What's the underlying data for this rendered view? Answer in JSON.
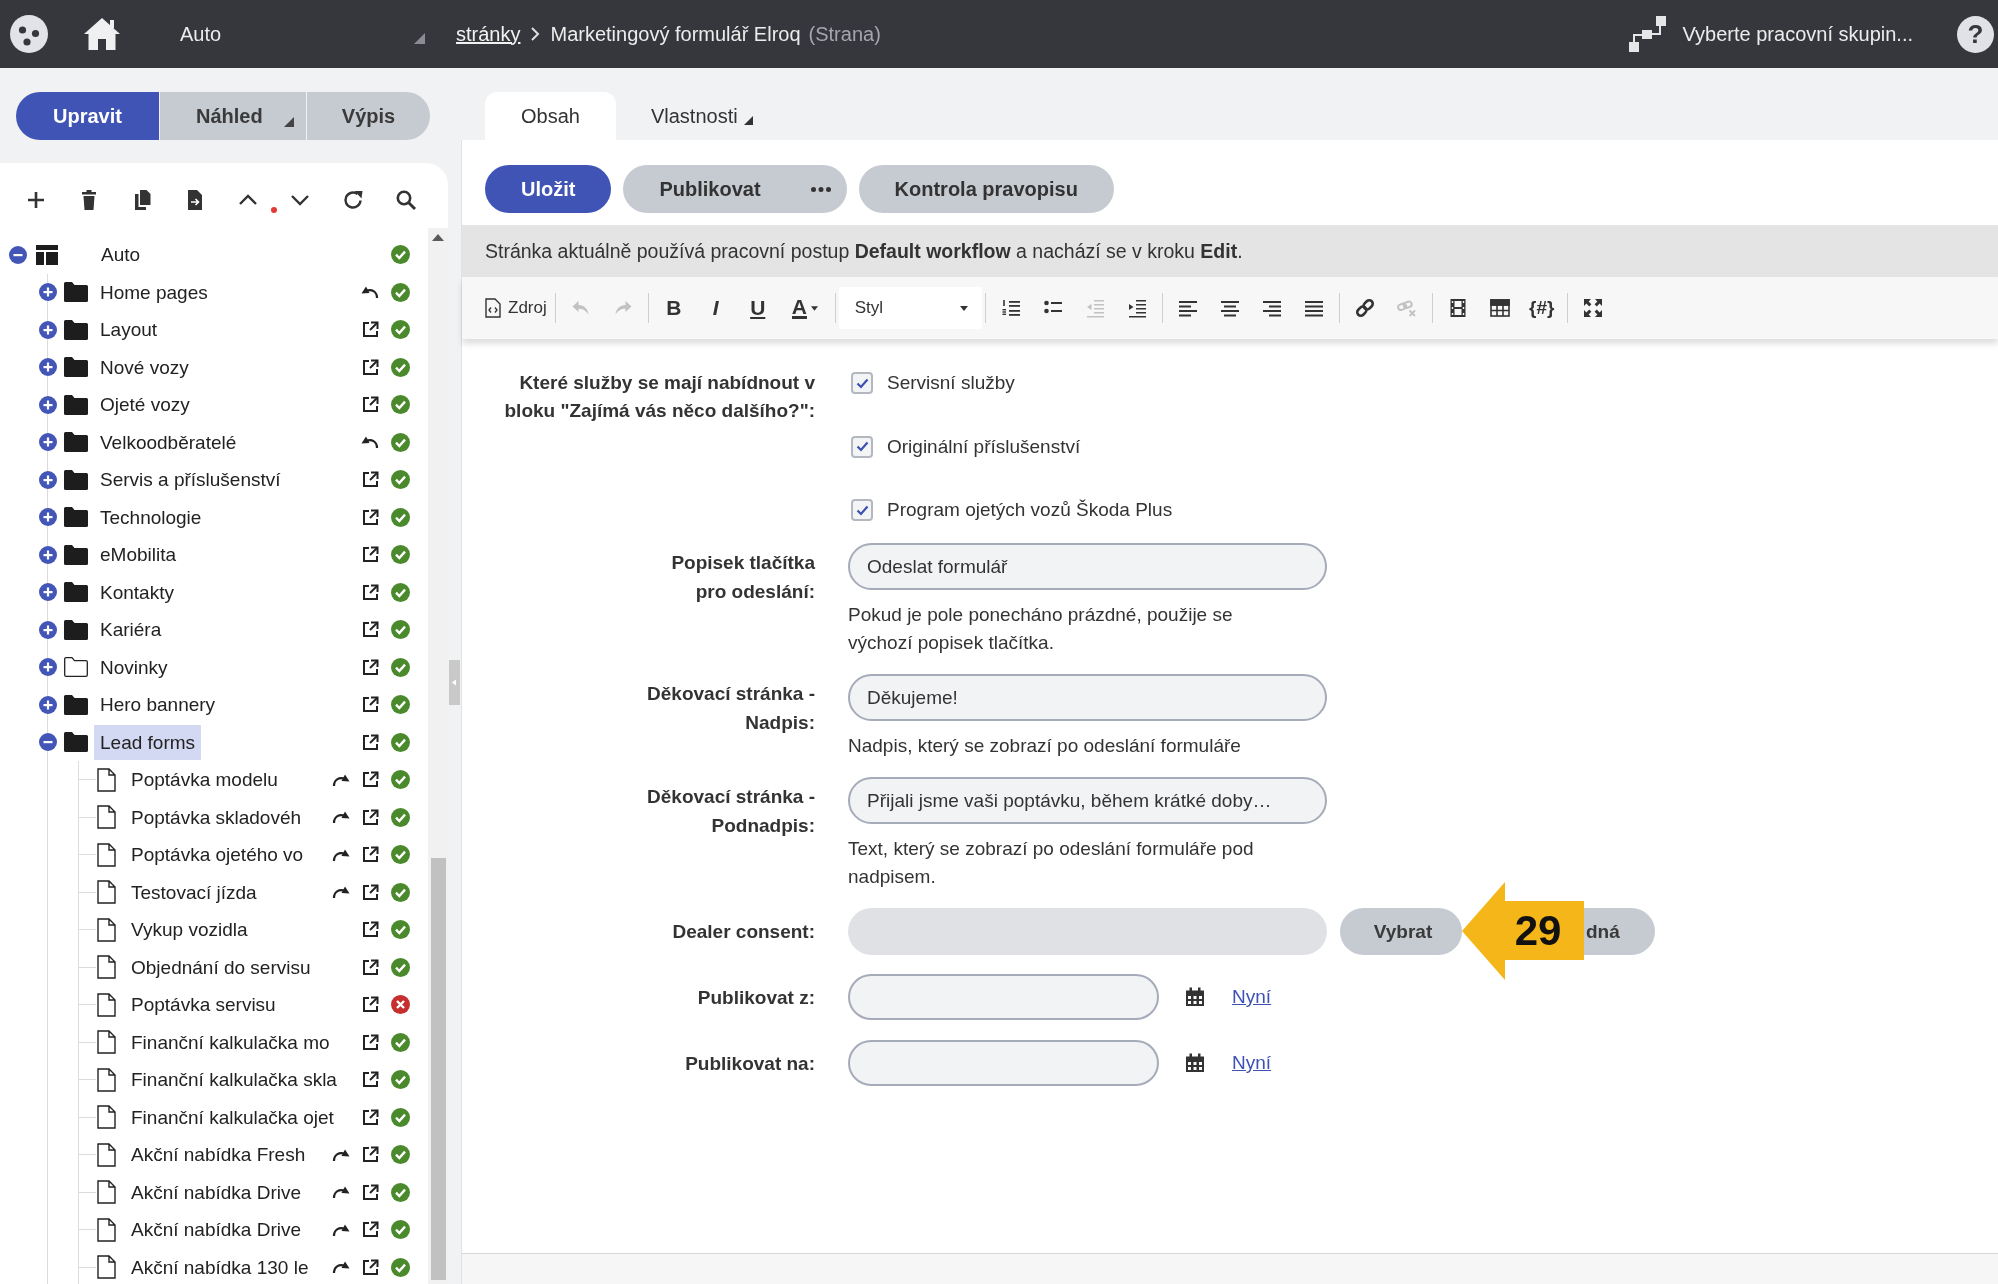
{
  "topbar": {
    "site": "Auto",
    "breadcrumb": {
      "link": "stránky",
      "current": "Marketingový formulář Elroq",
      "type": "(Strana)"
    },
    "workgroup": "Vyberte pracovní skupin...",
    "help": "?"
  },
  "modes": [
    {
      "label": "Upravit",
      "selected": true,
      "dropdown": false
    },
    {
      "label": "Náhled",
      "selected": false,
      "dropdown": true
    },
    {
      "label": "Výpis",
      "selected": false,
      "dropdown": false
    }
  ],
  "tree": {
    "items": [
      {
        "name": "Auto",
        "kind": "site",
        "expanded": true,
        "selected": false,
        "error": false,
        "undo": false,
        "redo": false,
        "external": false,
        "children": [
          {
            "name": "Home pages",
            "kind": "folder",
            "outline": false,
            "expanded": false,
            "selected": false,
            "error": false,
            "undo": true,
            "redo": false,
            "external": false
          },
          {
            "name": "Layout",
            "kind": "folder",
            "outline": false,
            "expanded": false,
            "selected": false,
            "error": false,
            "undo": false,
            "redo": false,
            "external": true
          },
          {
            "name": "Nové vozy",
            "kind": "folder",
            "outline": false,
            "expanded": false,
            "selected": false,
            "error": false,
            "undo": false,
            "redo": false,
            "external": true
          },
          {
            "name": "Ojeté vozy",
            "kind": "folder",
            "outline": false,
            "expanded": false,
            "selected": false,
            "error": false,
            "undo": false,
            "redo": false,
            "external": true
          },
          {
            "name": "Velkoodběratelé",
            "kind": "folder",
            "outline": false,
            "expanded": false,
            "selected": false,
            "error": false,
            "undo": true,
            "redo": false,
            "external": false
          },
          {
            "name": "Servis a příslušenství",
            "kind": "folder",
            "outline": false,
            "expanded": false,
            "selected": false,
            "error": false,
            "undo": false,
            "redo": false,
            "external": true
          },
          {
            "name": "Technologie",
            "kind": "folder",
            "outline": false,
            "expanded": false,
            "selected": false,
            "error": false,
            "undo": false,
            "redo": false,
            "external": true
          },
          {
            "name": "eMobilita",
            "kind": "folder",
            "outline": false,
            "expanded": false,
            "selected": false,
            "error": false,
            "undo": false,
            "redo": false,
            "external": true
          },
          {
            "name": "Kontakty",
            "kind": "folder",
            "outline": false,
            "expanded": false,
            "selected": false,
            "error": false,
            "undo": false,
            "redo": false,
            "external": true
          },
          {
            "name": "Kariéra",
            "kind": "folder",
            "outline": false,
            "expanded": false,
            "selected": false,
            "error": false,
            "undo": false,
            "redo": false,
            "external": true
          },
          {
            "name": "Novinky",
            "kind": "folder",
            "outline": true,
            "expanded": false,
            "selected": false,
            "error": false,
            "undo": false,
            "redo": false,
            "external": true
          },
          {
            "name": "Hero bannery",
            "kind": "folder",
            "outline": false,
            "expanded": false,
            "selected": false,
            "error": false,
            "undo": false,
            "redo": false,
            "external": true
          },
          {
            "name": "Lead forms",
            "kind": "folder",
            "outline": false,
            "expanded": true,
            "selected": true,
            "error": false,
            "undo": false,
            "redo": false,
            "external": true,
            "children": [
              {
                "name": "Poptávka modelu",
                "kind": "page",
                "selected": false,
                "error": false,
                "undo": false,
                "redo": true,
                "external": true
              },
              {
                "name": "Poptávka skladovéh",
                "kind": "page",
                "selected": false,
                "error": false,
                "undo": false,
                "redo": true,
                "external": true
              },
              {
                "name": "Poptávka ojetého vo",
                "kind": "page",
                "selected": false,
                "error": false,
                "undo": false,
                "redo": true,
                "external": true
              },
              {
                "name": "Testovací jízda",
                "kind": "page",
                "selected": false,
                "error": false,
                "undo": false,
                "redo": true,
                "external": true
              },
              {
                "name": "Vykup vozidla",
                "kind": "page",
                "selected": false,
                "error": false,
                "undo": false,
                "redo": false,
                "external": true
              },
              {
                "name": "Objednání do servisu",
                "kind": "page",
                "selected": false,
                "error": false,
                "undo": false,
                "redo": false,
                "external": true
              },
              {
                "name": "Poptávka servisu",
                "kind": "page",
                "selected": false,
                "error": true,
                "undo": false,
                "redo": false,
                "external": true
              },
              {
                "name": "Finanční kalkulačka mo",
                "kind": "page",
                "selected": false,
                "error": false,
                "undo": false,
                "redo": false,
                "external": true
              },
              {
                "name": "Finanční kalkulačka skla",
                "kind": "page",
                "selected": false,
                "error": false,
                "undo": false,
                "redo": false,
                "external": true
              },
              {
                "name": "Finanční kalkulačka ojet",
                "kind": "page",
                "selected": false,
                "error": false,
                "undo": false,
                "redo": false,
                "external": true
              },
              {
                "name": "Akční nabídka Fresh",
                "kind": "page",
                "selected": false,
                "error": false,
                "undo": false,
                "redo": true,
                "external": true
              },
              {
                "name": "Akční nabídka Drive",
                "kind": "page",
                "selected": false,
                "error": false,
                "undo": false,
                "redo": true,
                "external": true
              },
              {
                "name": "Akční nabídka Drive",
                "kind": "page",
                "selected": false,
                "error": false,
                "undo": false,
                "redo": true,
                "external": true
              },
              {
                "name": "Akční nabídka 130 le",
                "kind": "page",
                "selected": false,
                "error": false,
                "undo": false,
                "redo": true,
                "external": true
              }
            ]
          }
        ]
      }
    ]
  },
  "tabs": [
    {
      "label": "Obsah",
      "selected": true,
      "dropdown": false
    },
    {
      "label": "Vlastnosti",
      "selected": false,
      "dropdown": true
    }
  ],
  "actions": [
    {
      "label": "Uložit",
      "kind": "primary"
    },
    {
      "label": "Publikovat",
      "kind": "split"
    },
    {
      "label": "Kontrola pravopisu",
      "kind": "secondary"
    }
  ],
  "workflow_notice": "Stránka aktuálně používá pracovní postup **Default workflow** a nachází se v kroku **Edit**.",
  "editor_toolbar": {
    "groups": [
      [
        {
          "kind": "source",
          "label": "Zdroj",
          "disabled": false
        }
      ],
      [
        {
          "kind": "undo",
          "disabled": true
        },
        {
          "kind": "redo",
          "disabled": true
        }
      ],
      [
        {
          "kind": "bold",
          "label": "B",
          "disabled": false
        },
        {
          "kind": "italic",
          "label": "I",
          "disabled": false
        },
        {
          "kind": "underline",
          "label": "U",
          "disabled": false
        },
        {
          "kind": "color",
          "label": "A",
          "disabled": false
        }
      ],
      [
        {
          "kind": "style",
          "label": "Styl",
          "disabled": false
        }
      ],
      [
        {
          "kind": "numbered",
          "disabled": false
        },
        {
          "kind": "bulleted",
          "disabled": false
        },
        {
          "kind": "outdent",
          "disabled": true
        },
        {
          "kind": "indent",
          "disabled": false
        }
      ],
      [
        {
          "kind": "left",
          "disabled": false
        },
        {
          "kind": "center",
          "disabled": false
        },
        {
          "kind": "right",
          "disabled": false
        },
        {
          "kind": "justify",
          "disabled": false
        }
      ],
      [
        {
          "kind": "link",
          "disabled": false
        },
        {
          "kind": "unlink",
          "disabled": true
        }
      ],
      [
        {
          "kind": "media",
          "disabled": false
        },
        {
          "kind": "table",
          "disabled": false
        },
        {
          "kind": "placeholder",
          "label": "{#}",
          "disabled": false
        }
      ],
      [
        {
          "kind": "maximize",
          "disabled": false
        }
      ]
    ]
  },
  "form": {
    "rows": [
      {
        "kind": "checkboxes",
        "label": [
          "Které služby se mají nabídnout v",
          "bloku \"Zajímá vás něco dalšího?\":"
        ],
        "options": [
          {
            "label": "Servisní služby",
            "checked": true
          },
          {
            "label": "Originální příslušenství",
            "checked": true
          },
          {
            "label": "Program ojetých vozů Škoda Plus",
            "checked": true
          }
        ]
      },
      {
        "kind": "text",
        "label": [
          "Popisek tlačítka",
          "pro odeslání:"
        ],
        "value": "Odeslat formulář",
        "hint": "Pokud je pole ponecháno prázdné, použije se výchozí popisek tlačítka."
      },
      {
        "kind": "text",
        "label": [
          "Děkovací stránka -",
          "Nadpis:"
        ],
        "value": "Děkujeme!",
        "hint": "Nadpis, který se zobrazí po odeslání formuláře"
      },
      {
        "kind": "text",
        "label": [
          "Děkovací stránka -",
          "Podnadpis:"
        ],
        "value": "Přijali jsme vaši poptávku, během krátké doby…",
        "hint": "Text, který se zobrazí po odeslání formuláře pod nadpisem."
      },
      {
        "kind": "picker",
        "label": [
          "Dealer consent:"
        ],
        "buttons": [
          "Vybrat",
          "dná"
        ]
      },
      {
        "kind": "date",
        "label": [
          "Publikovat z:"
        ],
        "link": "Nyní"
      },
      {
        "kind": "date",
        "label": [
          "Publikovat na:"
        ],
        "link": "Nyní"
      }
    ]
  },
  "callout": {
    "number": "29"
  }
}
